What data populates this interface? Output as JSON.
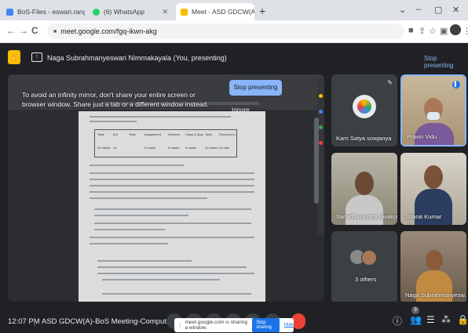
{
  "browser": {
    "tabs": [
      {
        "label": "BoS-Files - eswari.rangu@Gadg",
        "favicon_color": "#4285f4",
        "active": false
      },
      {
        "label": "(6) WhatsApp",
        "favicon_color": "#25d366",
        "active": false
      },
      {
        "label": "Meet - ASD GDCW(A)-BoS I",
        "favicon_color": "#fbbc04",
        "active": true
      }
    ],
    "new_tab": "+",
    "window_controls": {
      "minimize": "–",
      "maximize": "▢",
      "close": "✕",
      "dropdown": "⌄"
    },
    "nav": {
      "back": "←",
      "forward": "→",
      "reload": "C"
    },
    "url": "meet.google.com/fgq-ikwn-akg",
    "lock": "🔒"
  },
  "meet": {
    "presenter_label": "Naga Subrahmanyeswari Nimmakayala (You, presenting)",
    "stop_presenting_top": "Stop presenting",
    "overlay": {
      "message": "To avoid an infinity mirror, don't share your entire screen or browser window. Share just a tab or a different window instead.",
      "stop_presenting": "Stop presenting",
      "ignore": "Ignore"
    },
    "participants": [
      {
        "name": "Karri Satya sowjanya",
        "kind": "avatar"
      },
      {
        "name": "Pravin Vidu",
        "kind": "camera"
      },
      {
        "name": "Samidhamurthy Sivakoti",
        "kind": "camera"
      },
      {
        "name": "Sharat Kumar",
        "kind": "camera"
      },
      {
        "name": "3 others",
        "kind": "group"
      },
      {
        "name": "Naga Subrahmanyesw...",
        "kind": "camera"
      }
    ],
    "time": "12:07 PM",
    "separator": "|",
    "meeting_title": "ASD GDCW(A)-BoS Meeting-Computer S...",
    "share_notice": {
      "text": "meet.google.com is sharing a window.",
      "stop_sharing": "Stop sharing",
      "hide": "Hide"
    },
    "people_count": "9"
  },
  "document": {
    "table_headers": [
      "Total",
      "Ext",
      "Total",
      "Assignment",
      "Seminar",
      "Class & Quiz",
      "Total",
      "Reduced to"
    ],
    "table_values": [
      "20 marks",
      "10",
      "5 marks",
      "5 marks",
      "5 marks",
      "20 marks",
      "25 mks"
    ]
  }
}
